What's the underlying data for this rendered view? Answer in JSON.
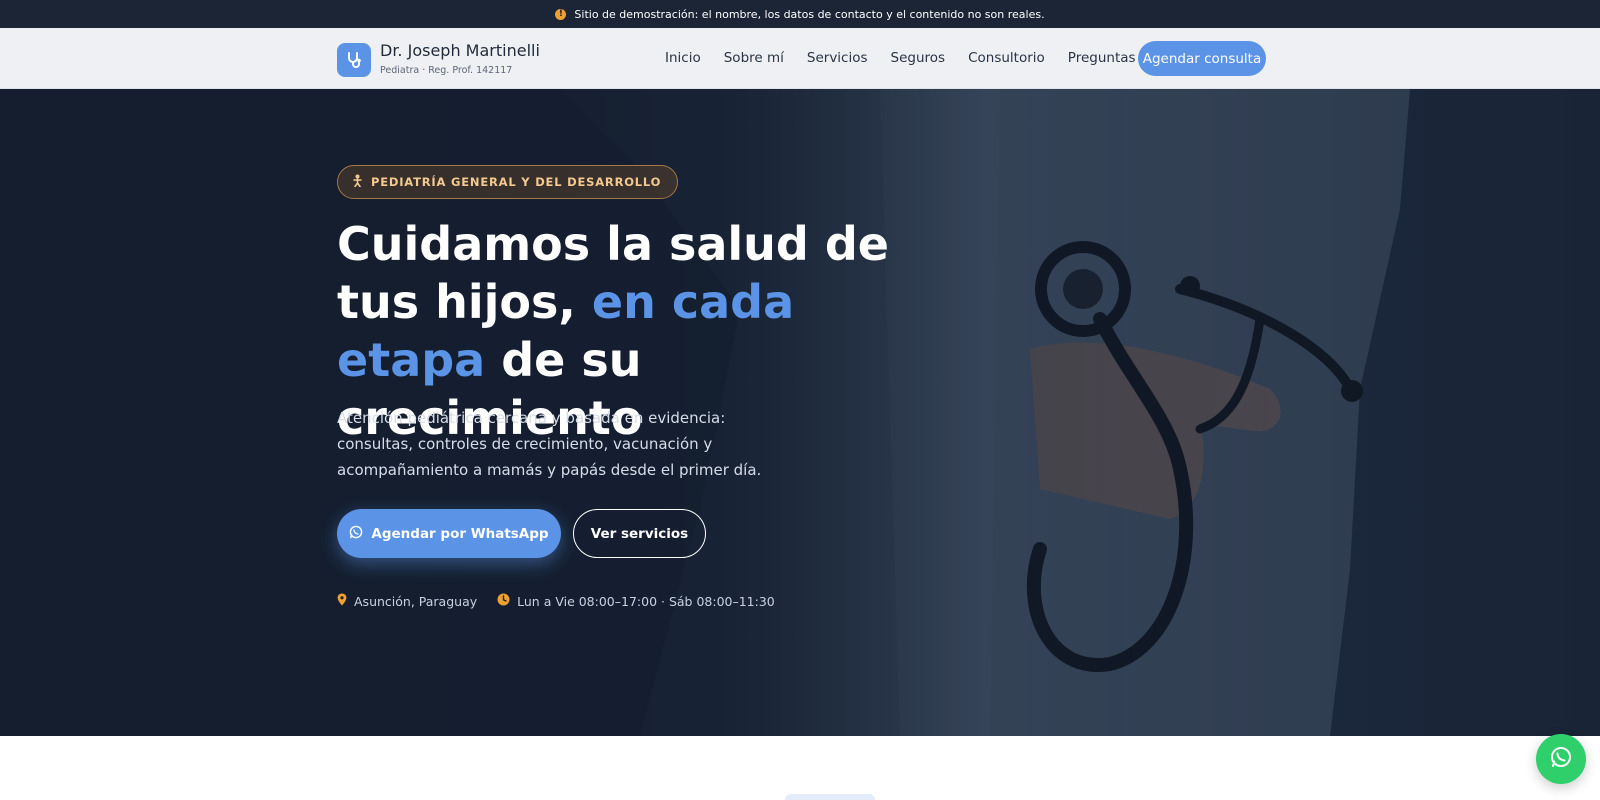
{
  "notice": {
    "text": "Sitio de demostración: el nombre, los datos de contacto y el contenido no son reales.",
    "icon": "info-icon"
  },
  "brand": {
    "name": "Dr. Joseph Martinelli",
    "subtitle": "Pediatra · Reg. Prof. 142117",
    "icon": "stethoscope-icon"
  },
  "nav": {
    "items": [
      "Inicio",
      "Sobre mí",
      "Servicios",
      "Seguros",
      "Consultorio",
      "Preguntas"
    ],
    "cta": "Agendar consulta"
  },
  "hero": {
    "badge": "PEDIATRÍA GENERAL Y DEL DESARROLLO",
    "headline_part1": "Cuidamos la salud de tus hijos, ",
    "headline_accent": "en cada etapa",
    "headline_part2": " de su crecimiento",
    "lead": "Atención pediátrica cercana y basada en evidencia: consultas, controles de crecimiento, vacunación y acompañamiento a mamás y papás desde el primer día.",
    "primary_button": "Agendar por WhatsApp",
    "secondary_button": "Ver servicios",
    "location": "Asunción, Paraguay",
    "hours": "Lun a Vie 08:00–17:00 · Sáb 08:00–11:30"
  },
  "colors": {
    "accent": "#5b93e6",
    "notice_bg": "#1b2535",
    "badge_text": "#f3c98f",
    "whatsapp": "#2fcf6c",
    "meta_icon": "#f0a030"
  }
}
